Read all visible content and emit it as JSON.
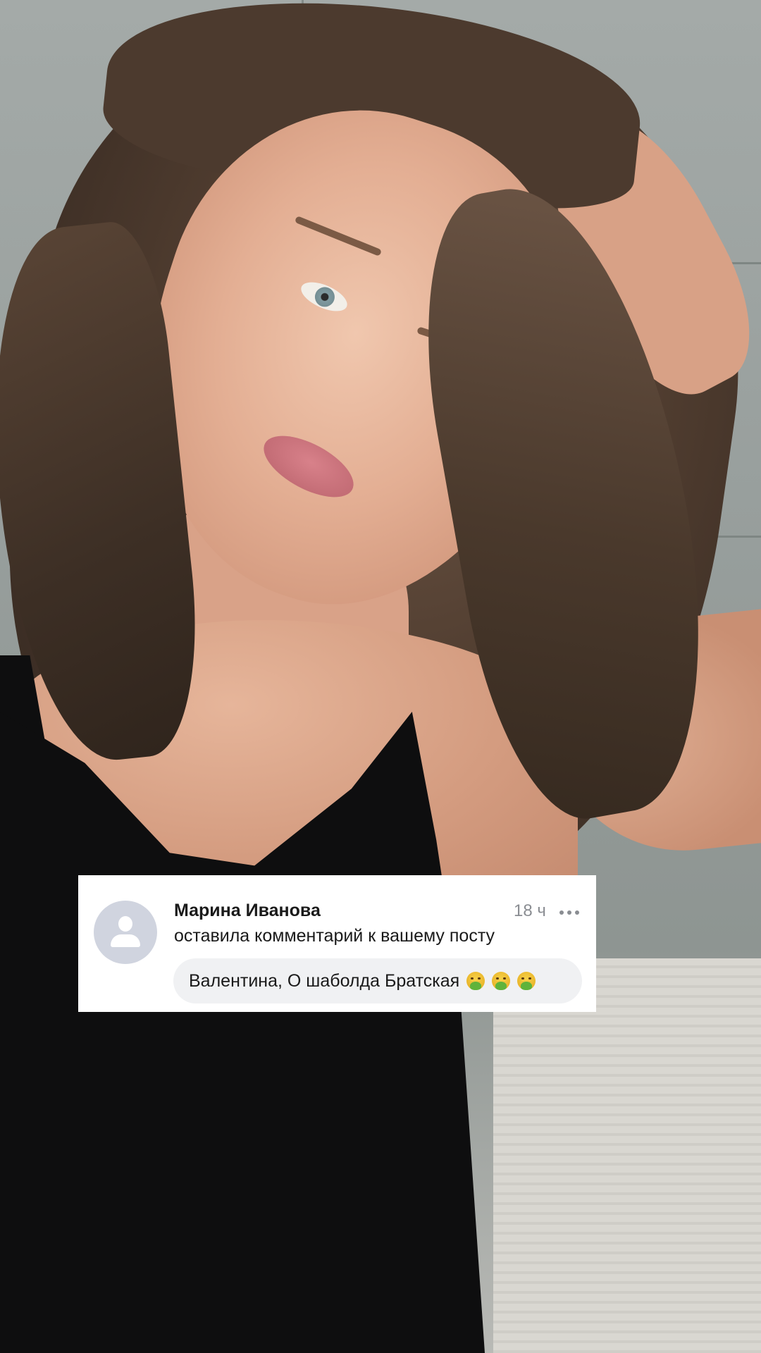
{
  "notification": {
    "author_name": "Марина Иванова",
    "time": "18 ч",
    "action_text": "оставила комментарий к вашему посту",
    "comment_text": "Валентина, О шаболда Братская",
    "comment_emojis": [
      "nauseated-face-emoji",
      "nauseated-face-emoji",
      "nauseated-face-emoji"
    ],
    "avatar": "default-user-avatar-icon",
    "more_icon": "more-options-icon"
  },
  "colors": {
    "card_background": "#ffffff",
    "bubble_background": "#f0f1f3",
    "avatar_background": "#d0d4df",
    "secondary_text": "#8a8d92",
    "primary_text": "#1a1a1a"
  }
}
